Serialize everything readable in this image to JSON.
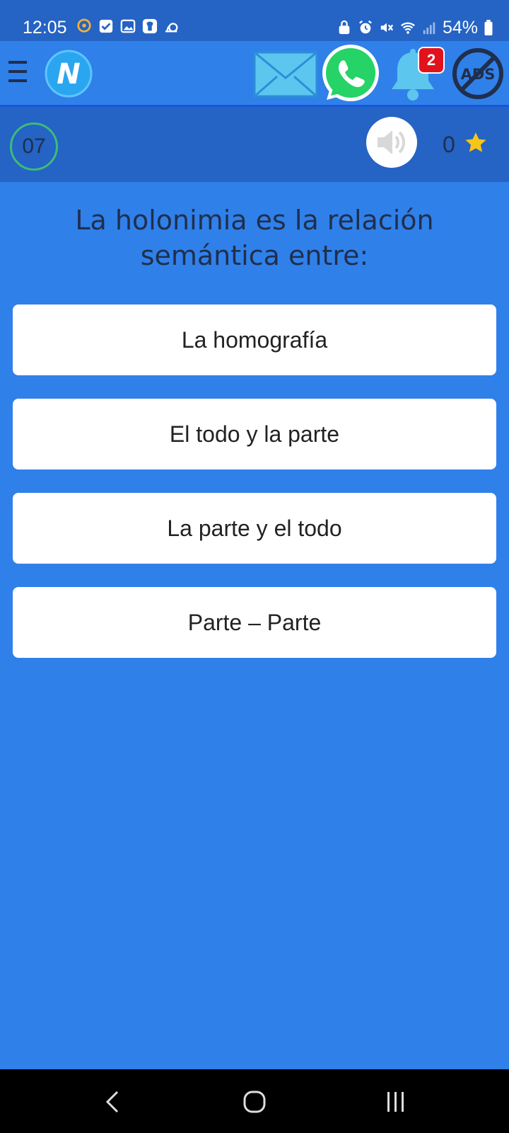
{
  "status_bar": {
    "time": "12:05",
    "battery": "54%"
  },
  "header": {
    "logo_letter": "N",
    "notification_count": "2",
    "ads_label": "ADS"
  },
  "quiz": {
    "counter": "07",
    "score": "0",
    "question": "La holonimia es la relación semántica entre:",
    "answers": [
      "La homografía",
      "El todo y la parte",
      "La parte y el todo",
      "Parte – Parte"
    ]
  },
  "colors": {
    "background": "#3080ea",
    "bar": "#2563c4",
    "badge": "#e0131c",
    "counter_ring": "#3dbb7a",
    "star": "#f5c518",
    "whatsapp": "#25d366"
  }
}
